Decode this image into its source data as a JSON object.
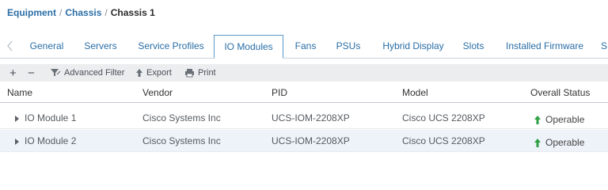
{
  "breadcrumb": {
    "items": [
      "Equipment",
      "Chassis"
    ],
    "separator": "/",
    "current": "Chassis 1"
  },
  "tabs": [
    {
      "label": "General"
    },
    {
      "label": "Servers"
    },
    {
      "label": "Service Profiles"
    },
    {
      "label": "IO Modules",
      "active": true
    },
    {
      "label": "Fans"
    },
    {
      "label": "PSUs"
    },
    {
      "label": "Hybrid Display"
    },
    {
      "label": "Slots"
    },
    {
      "label": "Installed Firmware"
    },
    {
      "label": "S"
    }
  ],
  "toolbar": {
    "add_icon": "+",
    "remove_icon": "−",
    "filter_label": "Advanced Filter",
    "export_label": "Export",
    "print_label": "Print"
  },
  "table": {
    "columns": [
      "Name",
      "Vendor",
      "PID",
      "Model",
      "Overall Status"
    ],
    "rows": [
      {
        "name": "IO Module 1",
        "vendor": "Cisco Systems Inc",
        "pid": "UCS-IOM-2208XP",
        "model": "Cisco UCS 2208XP",
        "status": "Operable"
      },
      {
        "name": "IO Module 2",
        "vendor": "Cisco Systems Inc",
        "pid": "UCS-IOM-2208XP",
        "model": "Cisco UCS 2208XP",
        "status": "Operable"
      }
    ]
  },
  "colors": {
    "link": "#2a6ea6",
    "status_ok": "#2ea043",
    "toolbar_bg": "#ebedef",
    "row_selected_bg": "#eef3f9"
  }
}
